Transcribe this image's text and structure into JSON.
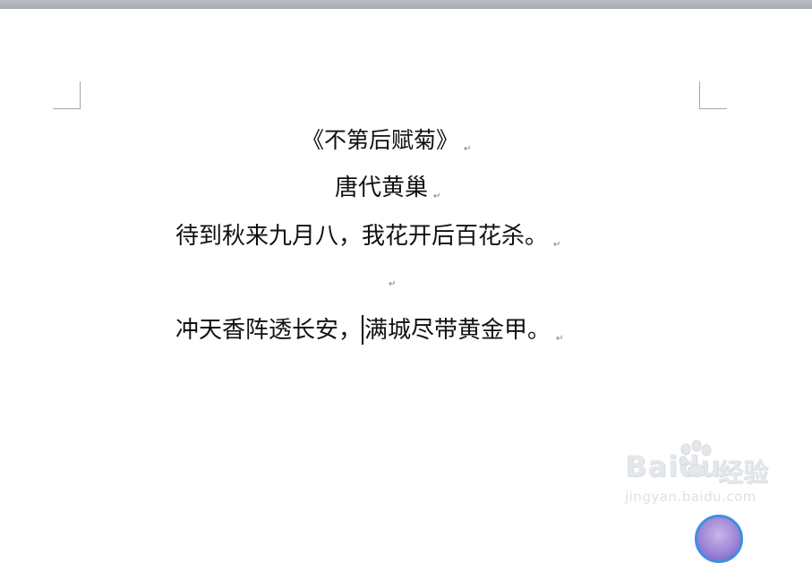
{
  "document": {
    "title_line": "《不第后赋菊》",
    "author_line": "唐代黄巢",
    "verse_1": "待到秋来九月八，我花开后百花杀。",
    "verse_2_before_cursor": "冲天香阵透长安，",
    "verse_2_after_cursor": "满城尽带黄金甲。",
    "paragraph_mark": "↵"
  },
  "watermark": {
    "brand": "Baidu",
    "brand_cn": "经验",
    "url": "jingyan.baidu.com"
  },
  "colors": {
    "top_bar": "#b0b3b8",
    "page_background": "#ffffff",
    "text": "#111111",
    "margin_corner": "#a6a6a6",
    "float_ball_border": "#3f8fe0"
  }
}
